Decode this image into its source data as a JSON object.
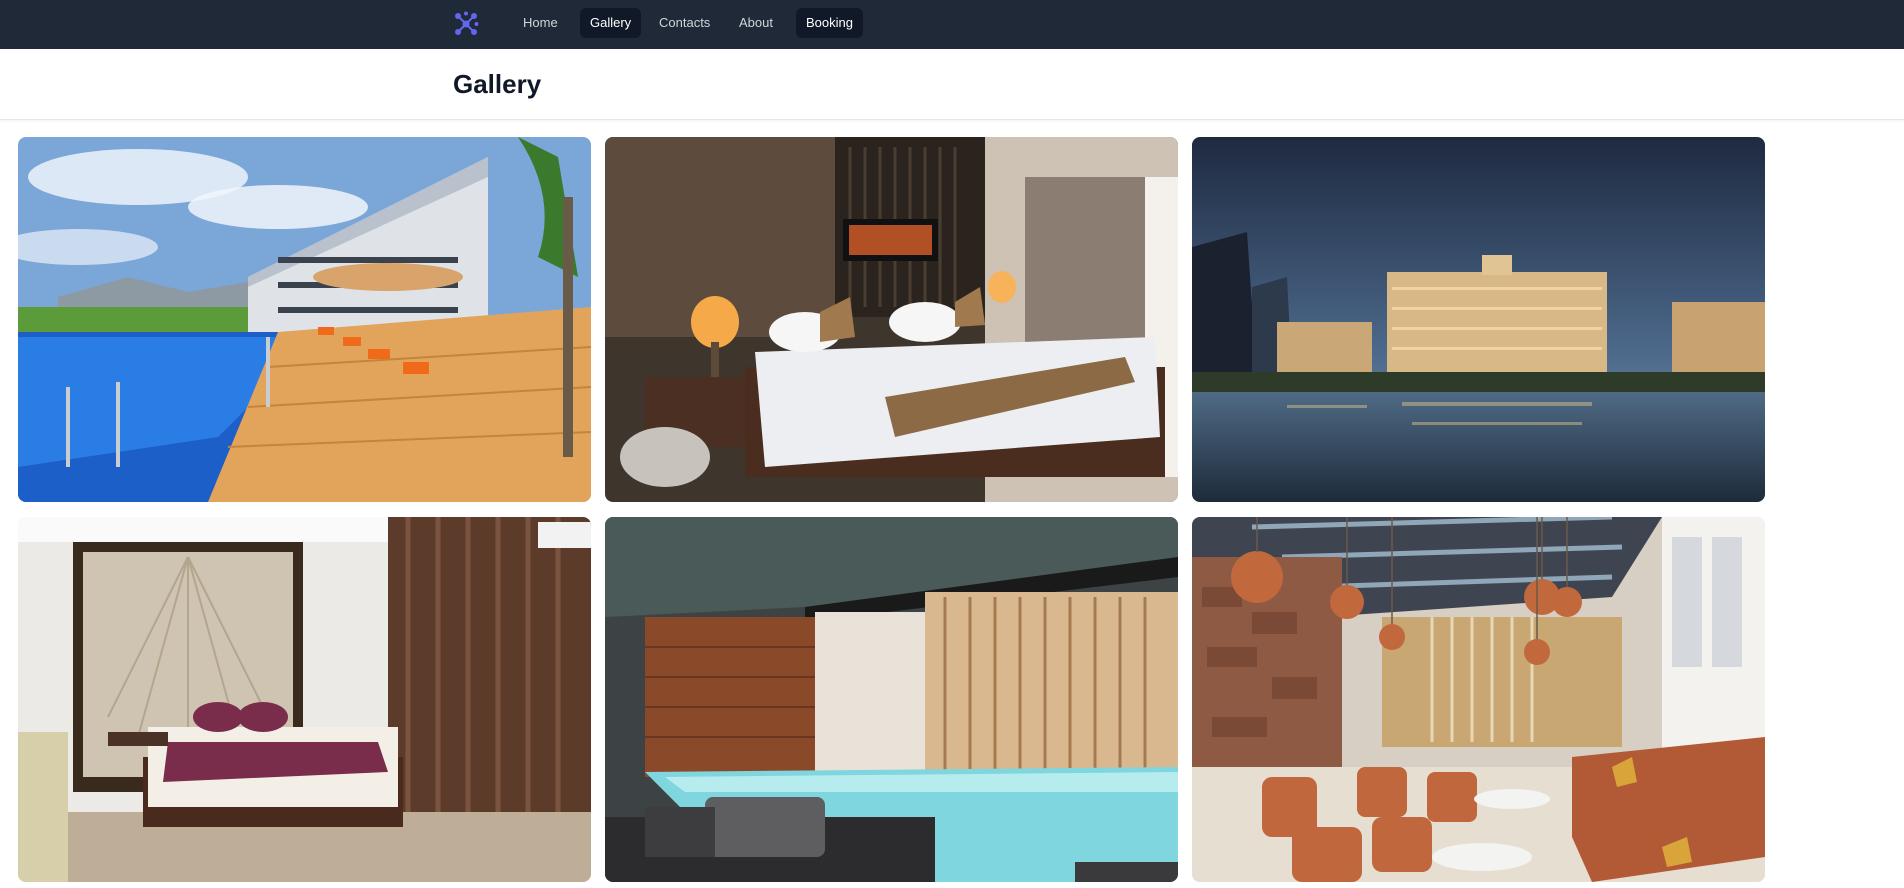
{
  "nav": {
    "logo_icon": "purple-molecule-logo-icon",
    "accent": "#6366f1",
    "background": "#1f2937",
    "links": [
      {
        "label": "Home",
        "active": false
      },
      {
        "label": "Gallery",
        "active": true
      },
      {
        "label": "Contacts",
        "active": false
      },
      {
        "label": "About",
        "active": false
      },
      {
        "label": "Booking",
        "active": true
      }
    ]
  },
  "header": {
    "title": "Gallery"
  },
  "gallery": {
    "images": [
      {
        "subject": "resort-pool-with-sun-loungers"
      },
      {
        "subject": "hotel-bedroom-with-lamps"
      },
      {
        "subject": "hotel-casino-at-dusk-over-water"
      },
      {
        "subject": "hotel-bedroom-with-brown-curtains"
      },
      {
        "subject": "indoor-swimming-pool"
      },
      {
        "subject": "lounge-with-copper-pendant-lights"
      }
    ]
  }
}
